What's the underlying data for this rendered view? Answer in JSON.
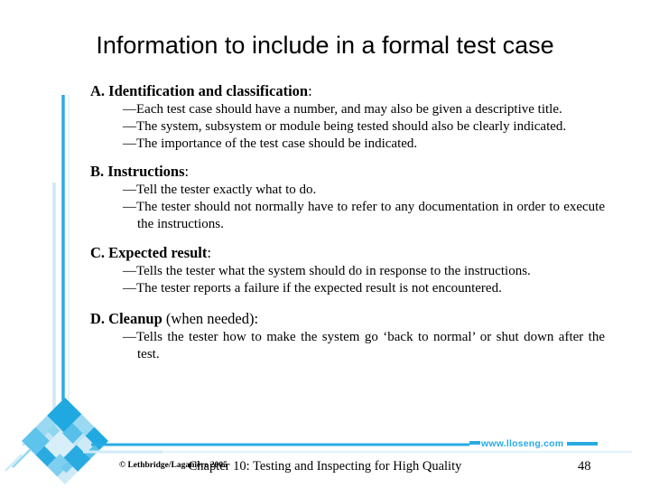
{
  "slide": {
    "title": "Information to include in a formal test case",
    "colors": {
      "cyan": "#29ABE2",
      "cyan_light": "#8FD6F0",
      "cyan_pale": "#CFEAF7",
      "text": "#000000",
      "background": "#FFFFFF"
    }
  },
  "sections": [
    {
      "label": "A. Identification and classification",
      "label_bold": "A. Identification and classification",
      "label_thin": ":",
      "bullets": [
        "—Each test case should have a number, and may also be given a descriptive title.",
        "—The system, subsystem or module being tested should also be clearly indicated.",
        "—The importance of the test case should be indicated."
      ]
    },
    {
      "label": "B. Instructions",
      "label_bold": "B. Instructions",
      "label_thin": ":",
      "bullets": [
        "—Tell the tester exactly what to do.",
        "—The tester should not normally have to refer to any documentation in order to execute the instructions."
      ]
    },
    {
      "label": "C. Expected result",
      "label_bold": "C. Expected result",
      "label_thin": ":",
      "bullets": [
        "—Tells the tester what the system should do in response to the instructions.",
        "—The tester reports a failure if the expected result is not encountered."
      ]
    },
    {
      "label": "D. Cleanup (when needed):",
      "label_bold": "D. Cleanup",
      "label_thin": " (when needed):",
      "bullets": [
        "—Tells the tester how to make the system go ‘back to normal’ or shut down after the test."
      ]
    }
  ],
  "footer": {
    "copyright": "© Lethbridge/Laganière 2005",
    "center": "Chapter 10: Testing and Inspecting for High Quality",
    "page": "48",
    "website": "www.lloseng.com"
  }
}
